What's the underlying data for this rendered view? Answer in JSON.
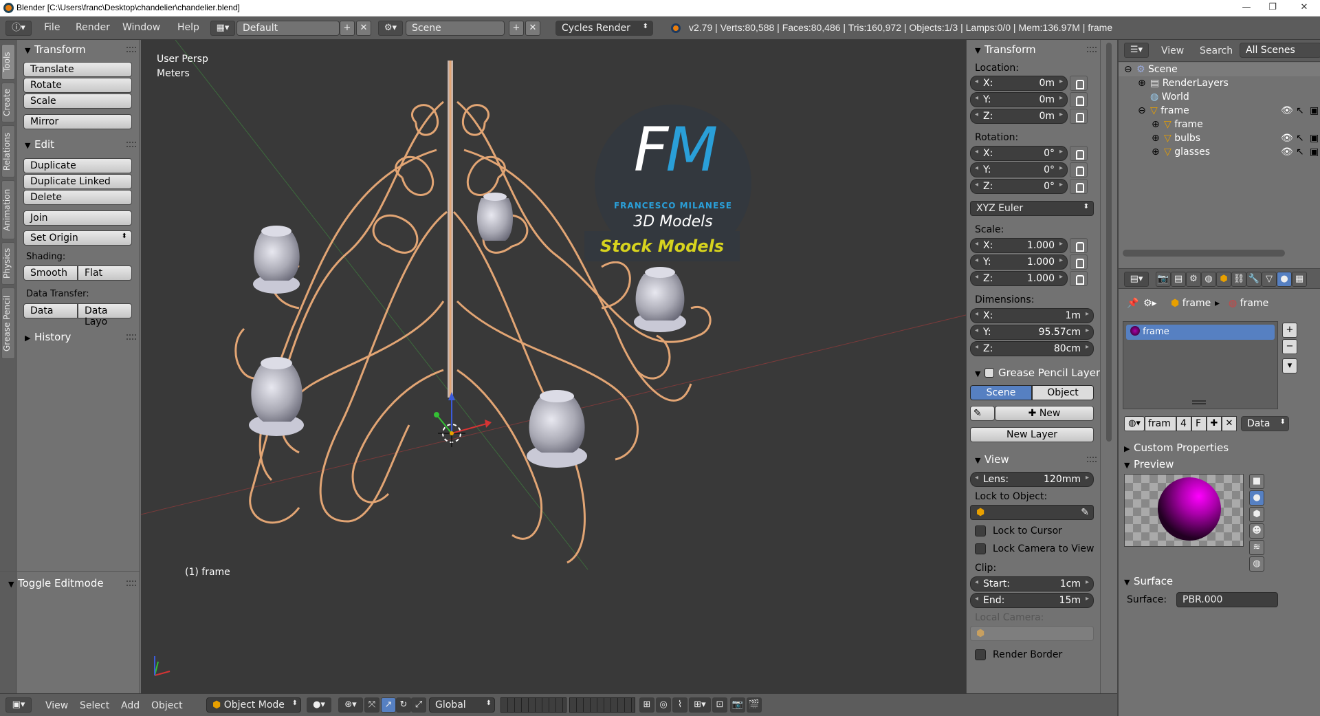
{
  "window": {
    "title": "Blender [C:\\Users\\franc\\Desktop\\chandelier\\chandelier.blend]",
    "minimize": "—",
    "maximize": "❐",
    "close": "✕"
  },
  "topbar": {
    "menus": [
      "File",
      "Render",
      "Window",
      "Help"
    ],
    "layout": "Default",
    "scene": "Scene",
    "engine": "Cycles Render",
    "stats": "v2.79 | Verts:80,588 | Faces:80,486 | Tris:160,972 | Objects:1/3 | Lamps:0/0 | Mem:136.97M | frame"
  },
  "left_tabs": [
    "Tools",
    "Create",
    "Relations",
    "Animation",
    "Physics",
    "Grease Pencil"
  ],
  "tools": {
    "transform_title": "Transform",
    "translate": "Translate",
    "rotate": "Rotate",
    "scale": "Scale",
    "mirror": "Mirror",
    "edit_title": "Edit",
    "duplicate": "Duplicate",
    "duplicate_linked": "Duplicate Linked",
    "delete": "Delete",
    "join": "Join",
    "set_origin": "Set Origin",
    "shading_label": "Shading:",
    "smooth": "Smooth",
    "flat": "Flat",
    "data_transfer_label": "Data Transfer:",
    "data": "Data",
    "data_layout": "Data Layo",
    "history": "History",
    "toggle_editmode": "Toggle Editmode"
  },
  "viewport": {
    "view_name": "User Persp",
    "units": "Meters",
    "object_label": "(1) frame",
    "logo_initials": "FM",
    "logo_name": "FRANCESCO MILANESE",
    "logo_sub": "3D Models",
    "logo_banner": "Stock Models"
  },
  "npanel": {
    "transform_title": "Transform",
    "location_label": "Location:",
    "location": [
      {
        "k": "X:",
        "v": "0m"
      },
      {
        "k": "Y:",
        "v": "0m"
      },
      {
        "k": "Z:",
        "v": "0m"
      }
    ],
    "rotation_label": "Rotation:",
    "rotation": [
      {
        "k": "X:",
        "v": "0°"
      },
      {
        "k": "Y:",
        "v": "0°"
      },
      {
        "k": "Z:",
        "v": "0°"
      }
    ],
    "rotation_mode": "XYZ Euler",
    "scale_label": "Scale:",
    "scale": [
      {
        "k": "X:",
        "v": "1.000"
      },
      {
        "k": "Y:",
        "v": "1.000"
      },
      {
        "k": "Z:",
        "v": "1.000"
      }
    ],
    "dimensions_label": "Dimensions:",
    "dimensions": [
      {
        "k": "X:",
        "v": "1m"
      },
      {
        "k": "Y:",
        "v": "95.57cm"
      },
      {
        "k": "Z:",
        "v": "80cm"
      }
    ],
    "gp_title": "Grease Pencil Layer",
    "gp_scene": "Scene",
    "gp_object": "Object",
    "gp_new": "New",
    "gp_new_layer": "New Layer",
    "view_title": "View",
    "lens_k": "Lens:",
    "lens_v": "120mm",
    "lock_to_object": "Lock to Object:",
    "lock_to_cursor": "Lock to Cursor",
    "lock_camera": "Lock Camera to View",
    "clip_label": "Clip:",
    "clip_start_k": "Start:",
    "clip_start_v": "1cm",
    "clip_end_k": "End:",
    "clip_end_v": "15m",
    "local_camera": "Local Camera:",
    "render_border": "Render Border"
  },
  "outliner": {
    "view": "View",
    "search": "Search",
    "filter": "All Scenes",
    "items": [
      "Scene",
      "RenderLayers",
      "World",
      "frame",
      "frame",
      "bulbs",
      "glasses"
    ]
  },
  "properties": {
    "crumb_object": "frame",
    "crumb_material": "frame",
    "material_slot": "frame",
    "mat_name": "fram",
    "mat_users": "4",
    "mat_fake": "F",
    "mat_link": "Data",
    "custom_props": "Custom Properties",
    "preview": "Preview",
    "surface_title": "Surface",
    "surface_label": "Surface:",
    "surface_value": "PBR.000"
  },
  "bottombar": {
    "menus": [
      "View",
      "Select",
      "Add",
      "Object"
    ],
    "mode": "Object Mode",
    "orientation": "Global"
  },
  "colors": {
    "panel": "#727272",
    "header": "#5c5c5c",
    "viewport": "#393939",
    "accent_blue": "#5680c2",
    "wire": "#e2a574",
    "logo_blue": "#2a9fd8",
    "logo_yellow": "#d7d31e"
  }
}
